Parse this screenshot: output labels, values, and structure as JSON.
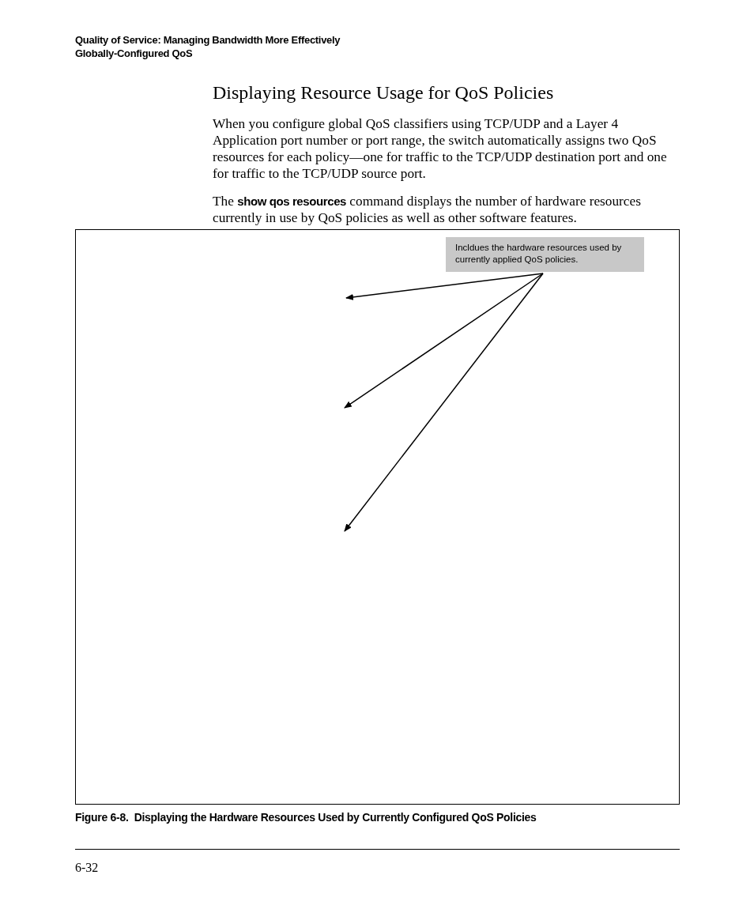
{
  "running_header": [
    "Quality of Service: Managing Bandwidth More Effectively",
    "Globally-Configured QoS"
  ],
  "section": {
    "heading": "Displaying Resource Usage for QoS Policies",
    "paragraphs": [
      "When you configure global QoS classifiers using TCP/UDP and a Layer 4 Application port number or port range, the switch automatically assigns two QoS resources for each policy—one for traffic to the TCP/UDP destination port and one for traffic to the TCP/UDP source port.",
      "The **show qos resources** command displays the number of hardware resources currently in use by QoS policies as well as other software features."
    ]
  },
  "figure": {
    "callout": "Incldues the hardware resources used by currently applied QoS policies.",
    "caption": "Figure 6-8.  Displaying the Hardware Resources Used by Currently Configured QoS Policies"
  },
  "page_number": "6-32"
}
